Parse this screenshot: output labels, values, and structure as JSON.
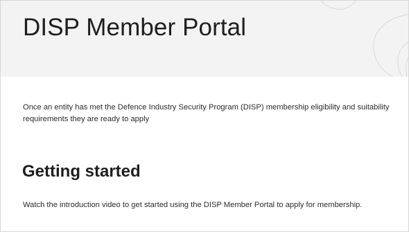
{
  "header": {
    "title": "DISP Member Portal"
  },
  "intro": {
    "text": "Once an entity has met the Defence Industry Security Program (DISP) membership eligibility and suitability requirements they are ready to apply"
  },
  "getting_started": {
    "heading": "Getting started",
    "text": "Watch the introduction video to get started using the DISP Member Portal to apply for membership."
  },
  "colors": {
    "banner_background": "#f3f3f3",
    "text": "#2b2b2b",
    "heading": "#1e1e1e"
  }
}
